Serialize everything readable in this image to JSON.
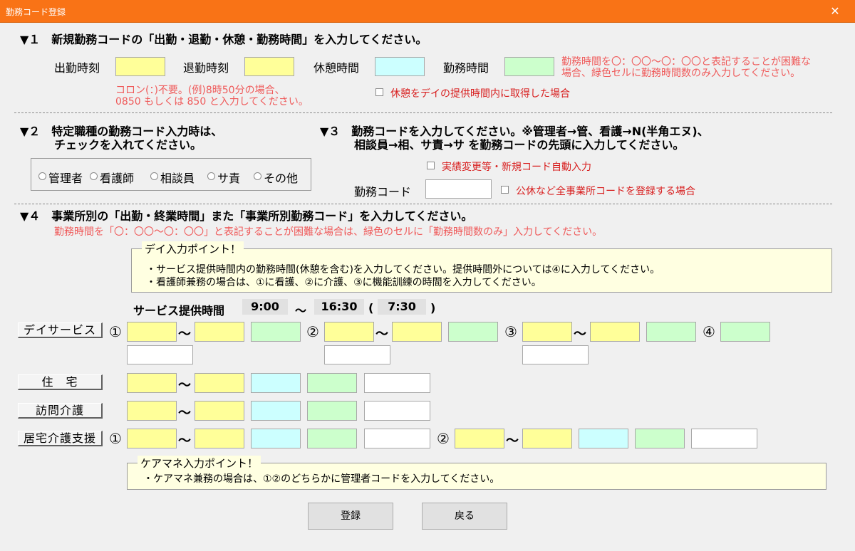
{
  "window": {
    "title": "勤務コード登録",
    "close_glyph": "✕"
  },
  "section1": {
    "heading": "▼１　新規勤務コードの「出勤・退勤・休憩・勤務時間」を入力してください。",
    "start_label": "出勤時刻",
    "end_label": "退勤時刻",
    "break_label": "休憩時間",
    "work_label": "勤務時間",
    "note_right_1": "勤務時間を〇：〇〇～〇：〇〇と表記することが困難な",
    "note_right_2": "場合、緑色セルに勤務時間数のみ入力してください。",
    "note_left_1": "コロン(：)不要。(例)8時50分の場合、",
    "note_left_2": "0850 もしくは 850 と入力してください。",
    "break_check_label": "休憩をデイの提供時間内に取得した場合"
  },
  "section2": {
    "heading_1": "▼２　特定職種の勤務コード入力時は、",
    "heading_2": "チェックを入れてください。",
    "radios": [
      "管理者",
      "看護師",
      "相談員",
      "サ責",
      "その他"
    ]
  },
  "section3": {
    "heading_1": "▼３　勤務コードを入力してください。※管理者→管、看護→N(半角エヌ)、",
    "heading_2": "相談員→相、サ責→サ を勤務コードの先頭に入力してください。",
    "auto_check_label": "実績変更等・新規コード自動入力",
    "code_label": "勤務コード",
    "all_office_check_label": "公休など全事業所コードを登録する場合"
  },
  "section4": {
    "heading": "▼４　事業所別の「出勤・終業時間」また「事業所別勤務コード」を入力してください。",
    "note": "勤務時間を「〇：〇〇～〇：〇〇」と表記することが困難な場合は、緑色のセルに「勤務時間数のみ」入力してください。",
    "day_point": {
      "title": "デイ入力ポイント！",
      "line1": "・サービス提供時間内の勤務時間(休憩を含む)を入力してください。提供時間外については④に入力してください。",
      "line2": "・看護師兼務の場合は、①に看護、②に介護、③に機能訓練の時間を入力してください。"
    },
    "service_time": {
      "label": "サービス提供時間",
      "start": "9:00",
      "sep": "～",
      "end": "16:30",
      "open": "(",
      "duration": "7:30",
      "close": ")"
    },
    "categories": {
      "day": "デイサービス",
      "housing": "住　宅",
      "visit": "訪問介護",
      "home_support": "居宅介護支援"
    },
    "marks": {
      "m1": "①",
      "m2": "②",
      "m3": "③",
      "m4": "④",
      "tilde": "～"
    },
    "caremana_point": {
      "title": "ケアマネ入力ポイント！",
      "line1": "・ケアマネ兼務の場合は、①②のどちらかに管理者コードを入力してください。"
    }
  },
  "buttons": {
    "register": "登録",
    "back": "戻る"
  },
  "colors": {
    "titlebar": "#f97316",
    "yellow_cell": "#ffff99",
    "cyan_cell": "#ccffff",
    "green_cell": "#ccffcc",
    "note_red": "#ef5a5a"
  }
}
